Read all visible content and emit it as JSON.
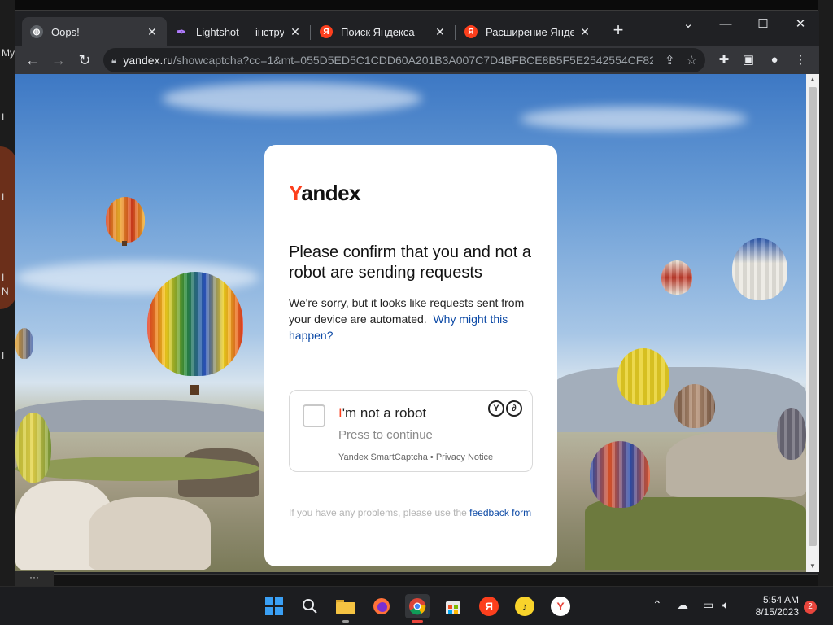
{
  "desktop": {
    "left_fragments": [
      "My",
      "I",
      "I",
      "I",
      "N",
      "I"
    ]
  },
  "tabs": [
    {
      "title": "Oops!",
      "icon": "globe-icon"
    },
    {
      "title": "Lightshot — інструмент",
      "icon": "feather-icon"
    },
    {
      "title": "Поиск Яндекса",
      "icon": "yandex-icon"
    },
    {
      "title": "Расширение Яндекса",
      "icon": "yandex-icon"
    }
  ],
  "window": {
    "new_tab": "+",
    "minimize": "—",
    "maximize": "☐",
    "close": "✕",
    "tab_list": "⌄"
  },
  "omnibox": {
    "domain": "yandex.ru",
    "path": "/showcaptcha?cc=1&mt=055D5ED5C1CDD60A201B3A007C7D4BFBCE8B5F5E2542554CF82..."
  },
  "captcha": {
    "logo_first": "Y",
    "logo_rest": "andex",
    "heading": "Please confirm that you and not a robot are sending requests",
    "description": "We're sorry, but it looks like requests sent from your device are automated.",
    "why_link": "Why might this happen?",
    "robot_first": "I",
    "robot_rest": "'m not a robot",
    "press": "Press to continue",
    "meta_service": "Yandex SmartCaptcha",
    "meta_sep": " • ",
    "meta_privacy": "Privacy Notice",
    "feedback_text": "If you have any problems, please use the ",
    "feedback_link": "feedback form"
  },
  "taskbar": {
    "apps": [
      "windows-start-icon",
      "search-icon",
      "file-explorer-icon",
      "firefox-icon",
      "chrome-icon",
      "store-icon",
      "yandex-icon",
      "yandex-music-icon",
      "yandex-browser-icon"
    ],
    "time": "5:54 AM",
    "date": "8/15/2023",
    "notifications": "2",
    "dots": "···"
  }
}
